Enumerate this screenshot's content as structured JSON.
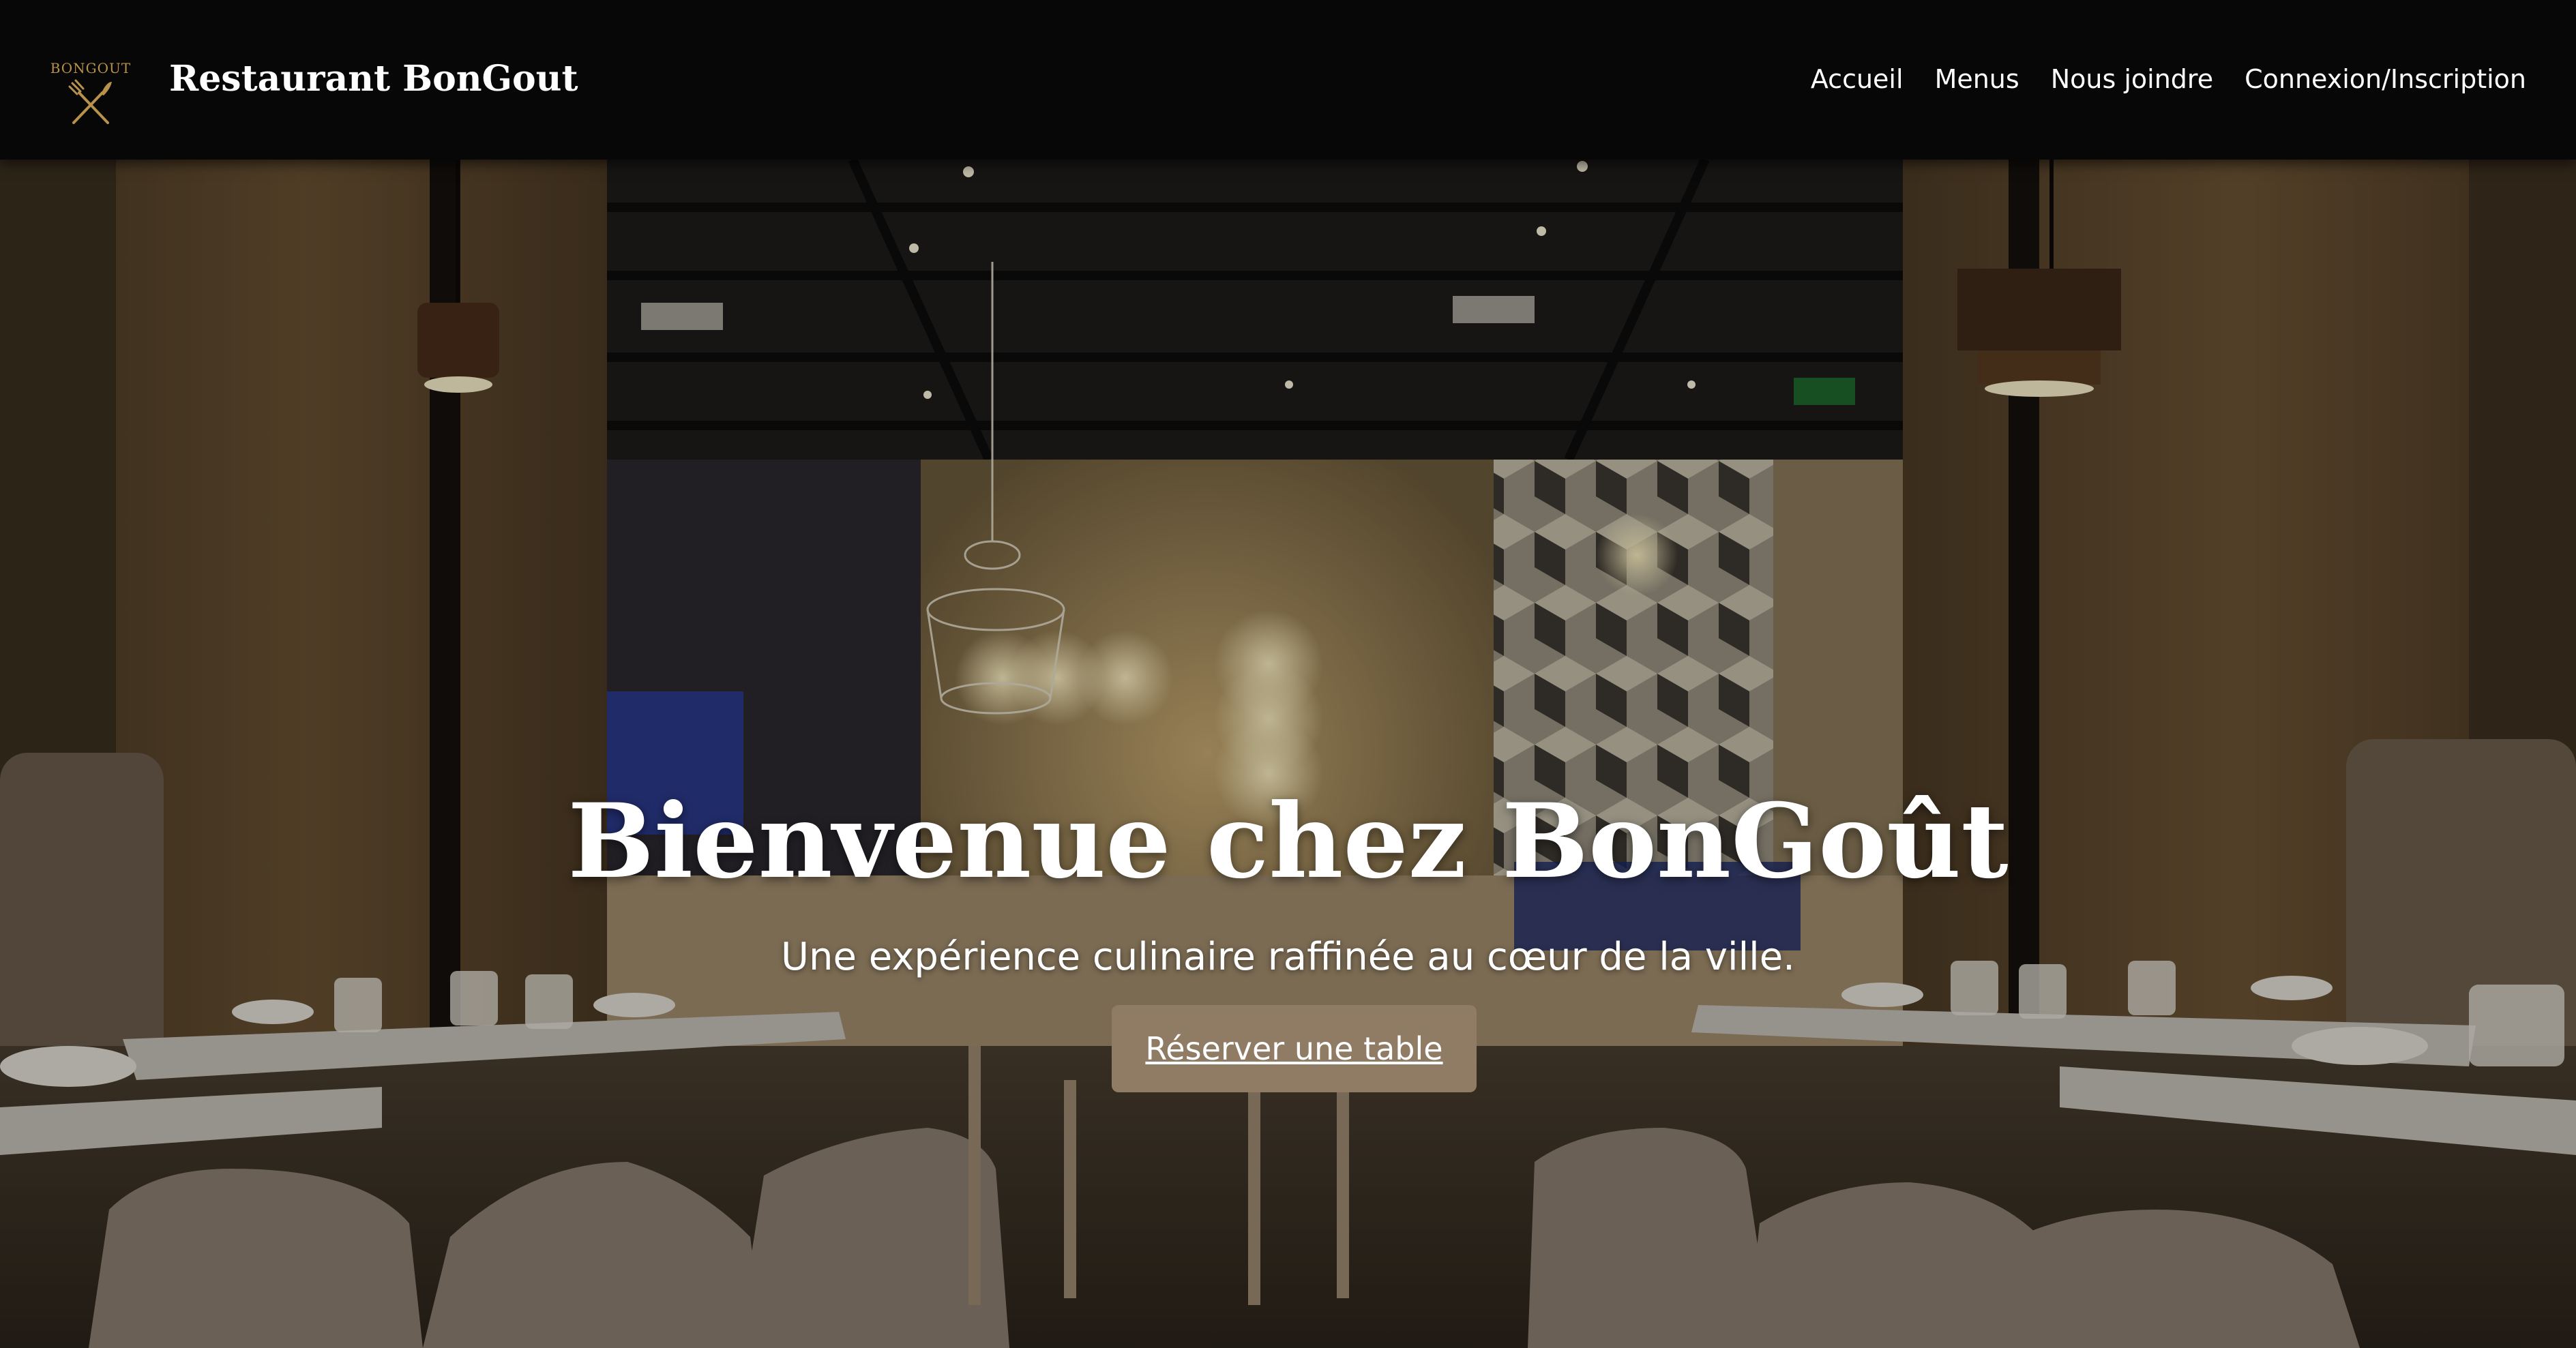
{
  "header": {
    "logo_text": "BONGOUT",
    "brand_name": "Restaurant BonGout",
    "nav": [
      {
        "label": "Accueil"
      },
      {
        "label": "Menus"
      },
      {
        "label": "Nous joindre"
      },
      {
        "label": "Connexion/Inscription"
      }
    ]
  },
  "hero": {
    "title": "Bienvenue chez BonGoût",
    "subtitle": "Une expérience culinaire raffinée au cœur de la ville.",
    "cta_label": "Réserver une table",
    "background_image": "dim-restaurant-dining-room-photo"
  },
  "colors": {
    "header_bg": "#070707",
    "logo_gold": "#b8924a",
    "cta_bg": "#907b64",
    "text": "#ffffff"
  }
}
